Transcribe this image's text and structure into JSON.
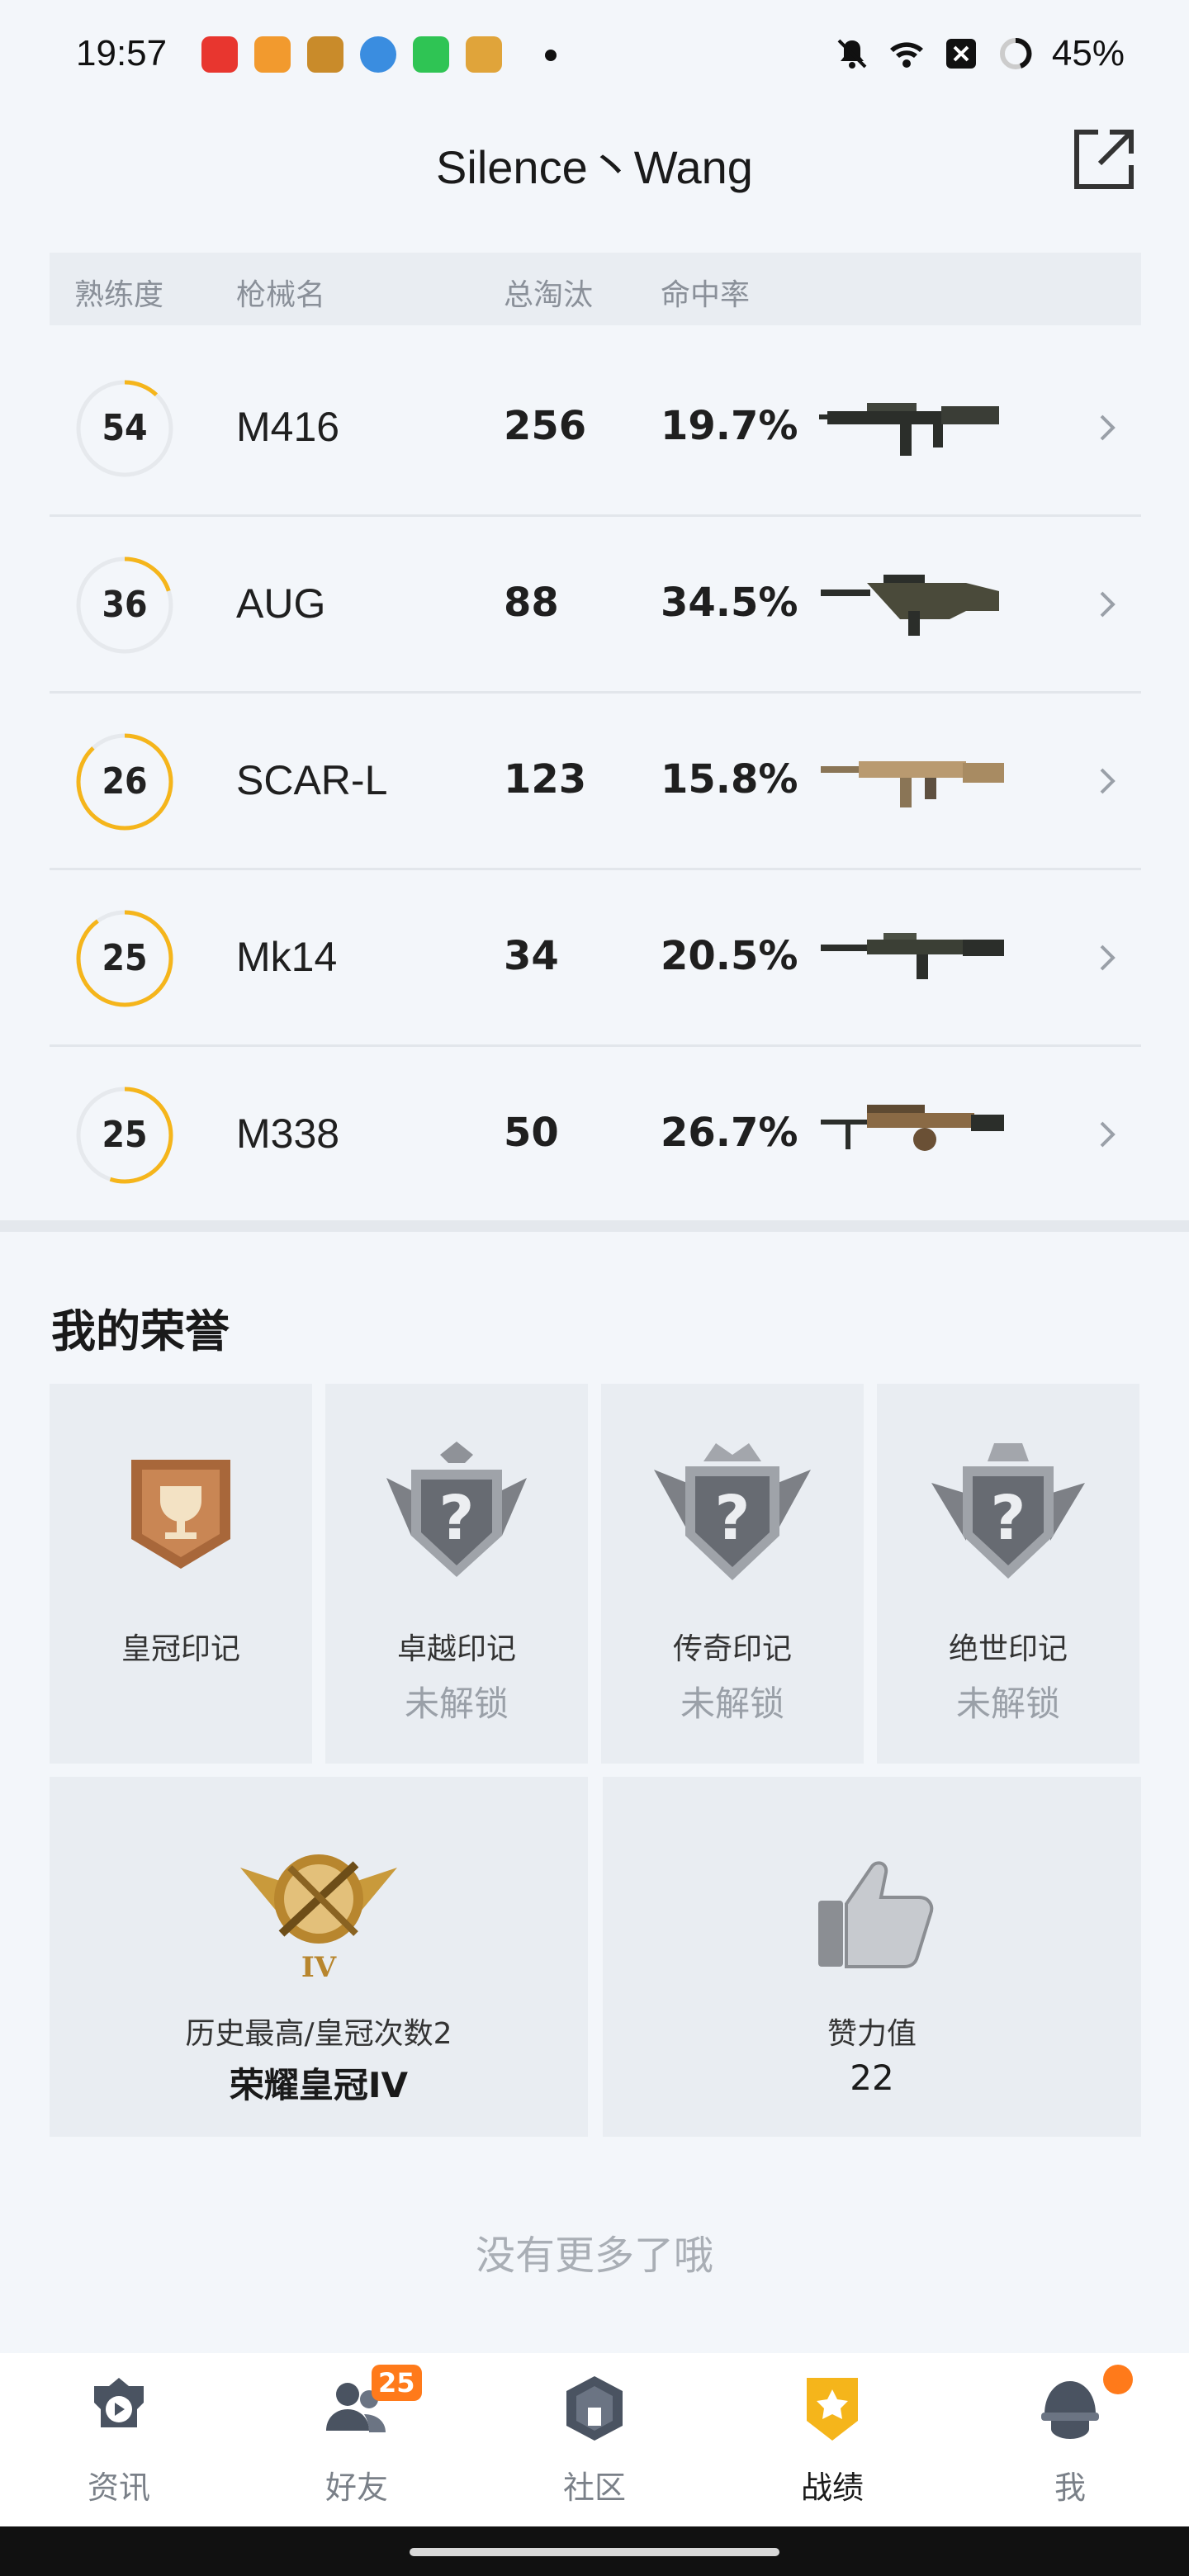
{
  "status_bar": {
    "time": "19:57",
    "battery": "45%",
    "icons": [
      "music-app-icon",
      "calendar-app-icon",
      "game-app-icon",
      "browser-app-icon",
      "messaging-app-icon",
      "target-app-icon",
      "notification-dot",
      "mute-icon",
      "wifi-icon",
      "sim-off-icon",
      "battery-ring-icon"
    ]
  },
  "header": {
    "title": "Silence丶Wang",
    "share_icon": "share-icon"
  },
  "table": {
    "columns": [
      "熟练度",
      "枪械名",
      "总淘汰",
      "命中率"
    ],
    "rows": [
      {
        "mastery": "54",
        "mastery_progress": 0.12,
        "name": "M416",
        "kills": "256",
        "hit_rate": "19.7%",
        "image": "m416-image"
      },
      {
        "mastery": "36",
        "mastery_progress": 0.2,
        "name": "AUG",
        "kills": "88",
        "hit_rate": "34.5%",
        "image": "aug-image"
      },
      {
        "mastery": "26",
        "mastery_progress": 0.88,
        "name": "SCAR-L",
        "kills": "123",
        "hit_rate": "15.8%",
        "image": "scar-l-image"
      },
      {
        "mastery": "25",
        "mastery_progress": 0.9,
        "name": "Mk14",
        "kills": "34",
        "hit_rate": "20.5%",
        "image": "mk14-image"
      },
      {
        "mastery": "25",
        "mastery_progress": 0.55,
        "name": "M338",
        "kills": "50",
        "hit_rate": "26.7%",
        "image": "m338-image"
      }
    ]
  },
  "honors": {
    "title": "我的荣誉",
    "marks": [
      {
        "name": "皇冠印记",
        "status": "",
        "icon": "crown-trophy-badge-icon"
      },
      {
        "name": "卓越印记",
        "status": "未解锁",
        "icon": "locked-excellence-badge-icon"
      },
      {
        "name": "传奇印记",
        "status": "未解锁",
        "icon": "locked-legend-badge-icon"
      },
      {
        "name": "绝世印记",
        "status": "未解锁",
        "icon": "locked-peerless-badge-icon"
      }
    ],
    "highest": {
      "label": "历史最高/皇冠次数2",
      "value": "荣耀皇冠IV",
      "icon": "crown-tier-badge-icon"
    },
    "likes": {
      "label": "赞力值",
      "value": "22",
      "icon": "thumbs-up-icon"
    }
  },
  "footer_text": "没有更多了哦",
  "bottom_nav": {
    "items": [
      {
        "label": "资讯",
        "icon": "news-icon"
      },
      {
        "label": "好友",
        "icon": "friends-icon",
        "badge": "25"
      },
      {
        "label": "社区",
        "icon": "community-icon"
      },
      {
        "label": "战绩",
        "icon": "record-icon",
        "active": true
      },
      {
        "label": "我",
        "icon": "profile-icon",
        "dot": true
      }
    ]
  },
  "colors": {
    "accent": "#f5b51b",
    "badge": "#ff7a1a",
    "ring_track": "#e6e9ed"
  }
}
